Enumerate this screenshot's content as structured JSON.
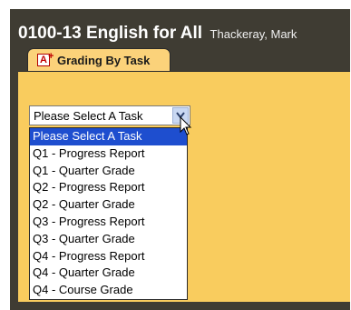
{
  "header": {
    "course": "0100-13 English for All",
    "teacher": "Thackeray, Mark"
  },
  "tab": {
    "label": "Grading By Task",
    "icon": "a-plus-icon",
    "icon_letter": "A",
    "icon_plus": "+"
  },
  "task_select": {
    "value": "Please Select A Task",
    "options": [
      "Please Select A Task",
      "Q1 - Progress Report",
      "Q1 - Quarter Grade",
      "Q2 - Progress Report",
      "Q2 - Quarter Grade",
      "Q3 - Progress Report",
      "Q3 - Quarter Grade",
      "Q4 - Progress Report",
      "Q4 - Quarter Grade",
      "Q4 - Course Grade"
    ],
    "highlighted_index": 0
  },
  "colors": {
    "frame": "#3f3c33",
    "panel": "#f9cc5e",
    "tab": "#fbd27a",
    "highlight": "#1e4ecf"
  }
}
